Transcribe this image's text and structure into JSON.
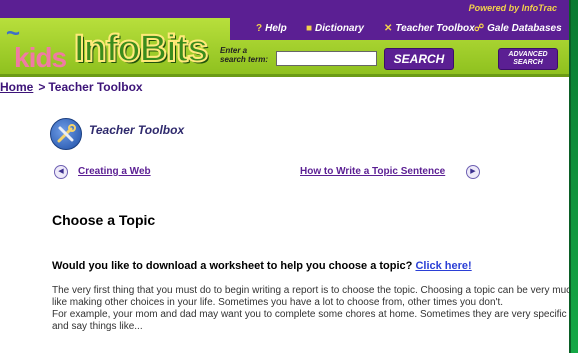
{
  "header": {
    "powered_by": "Powered by InfoTrac",
    "nav": [
      {
        "label": "Help",
        "icon": "help-icon"
      },
      {
        "label": "Dictionary",
        "icon": "book-icon"
      },
      {
        "label": "Teacher Toolbox",
        "icon": "tools-icon"
      },
      {
        "label": "Gale Databases",
        "icon": "link-icon"
      }
    ],
    "logo": {
      "kids": "kids",
      "info": "InfoBits"
    },
    "search": {
      "label_line1": "Enter a",
      "label_line2": "search term:",
      "value": "",
      "button": "SEARCH",
      "advanced_line1": "ADVANCED",
      "advanced_line2": "SEARCH"
    }
  },
  "breadcrumb": {
    "home": "Home",
    "separator": ">",
    "current": "Teacher Toolbox"
  },
  "toolbox_title": "Teacher Toolbox",
  "prev_link": "Creating a Web",
  "next_link": "How to Write a Topic Sentence",
  "section_title": "Choose a Topic",
  "question": "Would you like to download a worksheet to help you choose a topic?",
  "question_link": "Click here!",
  "body_text": "The very first thing that you must do to begin writing a report is to choose the topic. Choosing a topic can be very much like making other choices in your life. Sometimes you have a lot to choose from, other times you don't.\nFor example, your mom and dad may want you to complete some chores at home. Sometimes they are very specific and say things like...",
  "colors": {
    "purple": "#5b1f93",
    "lime": "#a6d32e",
    "link": "#2b3fd6"
  }
}
